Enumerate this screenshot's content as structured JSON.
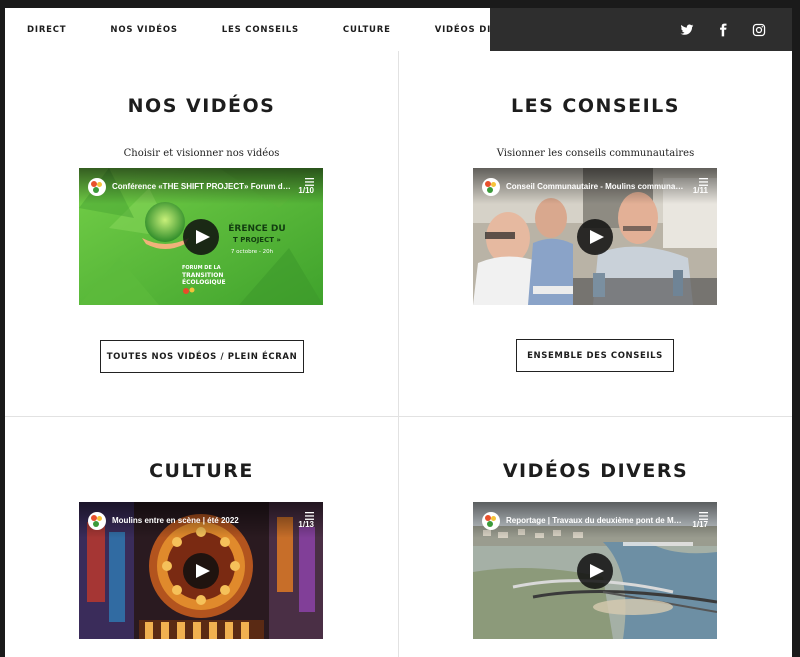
{
  "nav": {
    "items": [
      {
        "label": "DIRECT",
        "name": "nav-direct"
      },
      {
        "label": "NOS VIDÉOS",
        "name": "nav-nos-videos"
      },
      {
        "label": "LES CONSEILS",
        "name": "nav-les-conseils"
      },
      {
        "label": "CULTURE",
        "name": "nav-culture"
      },
      {
        "label": "VIDÉOS DIVERS",
        "name": "nav-videos-divers"
      }
    ],
    "social": [
      "twitter-icon",
      "facebook-icon",
      "instagram-icon"
    ]
  },
  "sections": {
    "videos": {
      "title": "NOS VIDÉOS",
      "subtitle": "Choisir et visionner nos vidéos",
      "video_title": "Conférence «THE SHIFT PROJECT» Forum de la transition écologique",
      "playlist_count": "1/10",
      "button_label": "TOUTES NOS VIDÉOS / PLEIN ÉCRAN",
      "thumb_text": {
        "line1": "ÉRENCE DU",
        "line2": "T PROJECT »",
        "line3": "7 octobre - 20h",
        "forum1": "FORUM DE LA",
        "forum2": "TRANSITION",
        "forum3": "ÉCOLOGIQUE"
      }
    },
    "conseils": {
      "title": "LES CONSEILS",
      "subtitle": "Visionner les conseils communautaires",
      "video_title": "Conseil Communautaire - Moulins communauté",
      "playlist_count": "1/11",
      "button_label": "ENSEMBLE DES CONSEILS"
    },
    "culture": {
      "title": "CULTURE",
      "video_title": "Moulins entre en scène | été 2022",
      "playlist_count": "1/13"
    },
    "divers": {
      "title": "VIDÉOS DIVERS",
      "video_title": "Reportage | Travaux du deuxième pont de Moulins",
      "playlist_count": "1/17"
    }
  },
  "colors": {
    "nav_dark": "#2e2e2e",
    "text": "#1c1c1c",
    "divider": "#e2e2e2"
  }
}
